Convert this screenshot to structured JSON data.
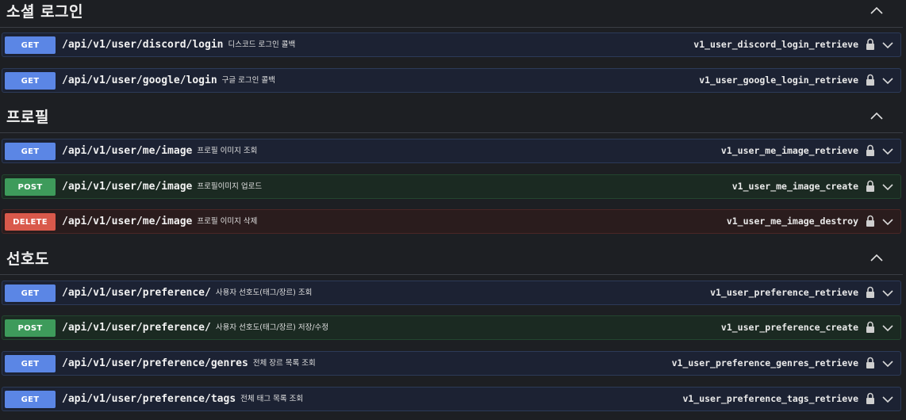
{
  "sections": [
    {
      "title": "소셜 로그인",
      "operations": [
        {
          "method": "GET",
          "path": "/api/v1/user/discord/login",
          "summary": "디스코드 로그인 콜백",
          "operation_id": "v1_user_discord_login_retrieve"
        },
        {
          "method": "GET",
          "path": "/api/v1/user/google/login",
          "summary": "구글 로그인 콜백",
          "operation_id": "v1_user_google_login_retrieve"
        }
      ]
    },
    {
      "title": "프로필",
      "operations": [
        {
          "method": "GET",
          "path": "/api/v1/user/me/image",
          "summary": "프로필 이미지 조회",
          "operation_id": "v1_user_me_image_retrieve"
        },
        {
          "method": "POST",
          "path": "/api/v1/user/me/image",
          "summary": "프로필이미지 업로드",
          "operation_id": "v1_user_me_image_create"
        },
        {
          "method": "DELETE",
          "path": "/api/v1/user/me/image",
          "summary": "프로필 이미지 삭제",
          "operation_id": "v1_user_me_image_destroy"
        }
      ]
    },
    {
      "title": "선호도",
      "operations": [
        {
          "method": "GET",
          "path": "/api/v1/user/preference/",
          "summary": "사용자 선호도(태그/장르) 조회",
          "operation_id": "v1_user_preference_retrieve"
        },
        {
          "method": "POST",
          "path": "/api/v1/user/preference/",
          "summary": "사용자 선호도(태그/장르) 저장/수정",
          "operation_id": "v1_user_preference_create"
        },
        {
          "method": "GET",
          "path": "/api/v1/user/preference/genres",
          "summary": "전체 장르 목록 조회",
          "operation_id": "v1_user_preference_genres_retrieve"
        },
        {
          "method": "GET",
          "path": "/api/v1/user/preference/tags",
          "summary": "전체 태그 목록 조회",
          "operation_id": "v1_user_preference_tags_retrieve"
        }
      ]
    }
  ],
  "colors": {
    "get": "#5b86e5",
    "post": "#3e9b5b",
    "delete": "#d9594b",
    "background": "#1d1f23"
  },
  "icons": {
    "section_toggle": "chevron-up-icon",
    "lock": "lock-icon",
    "expand": "chevron-down-icon"
  }
}
